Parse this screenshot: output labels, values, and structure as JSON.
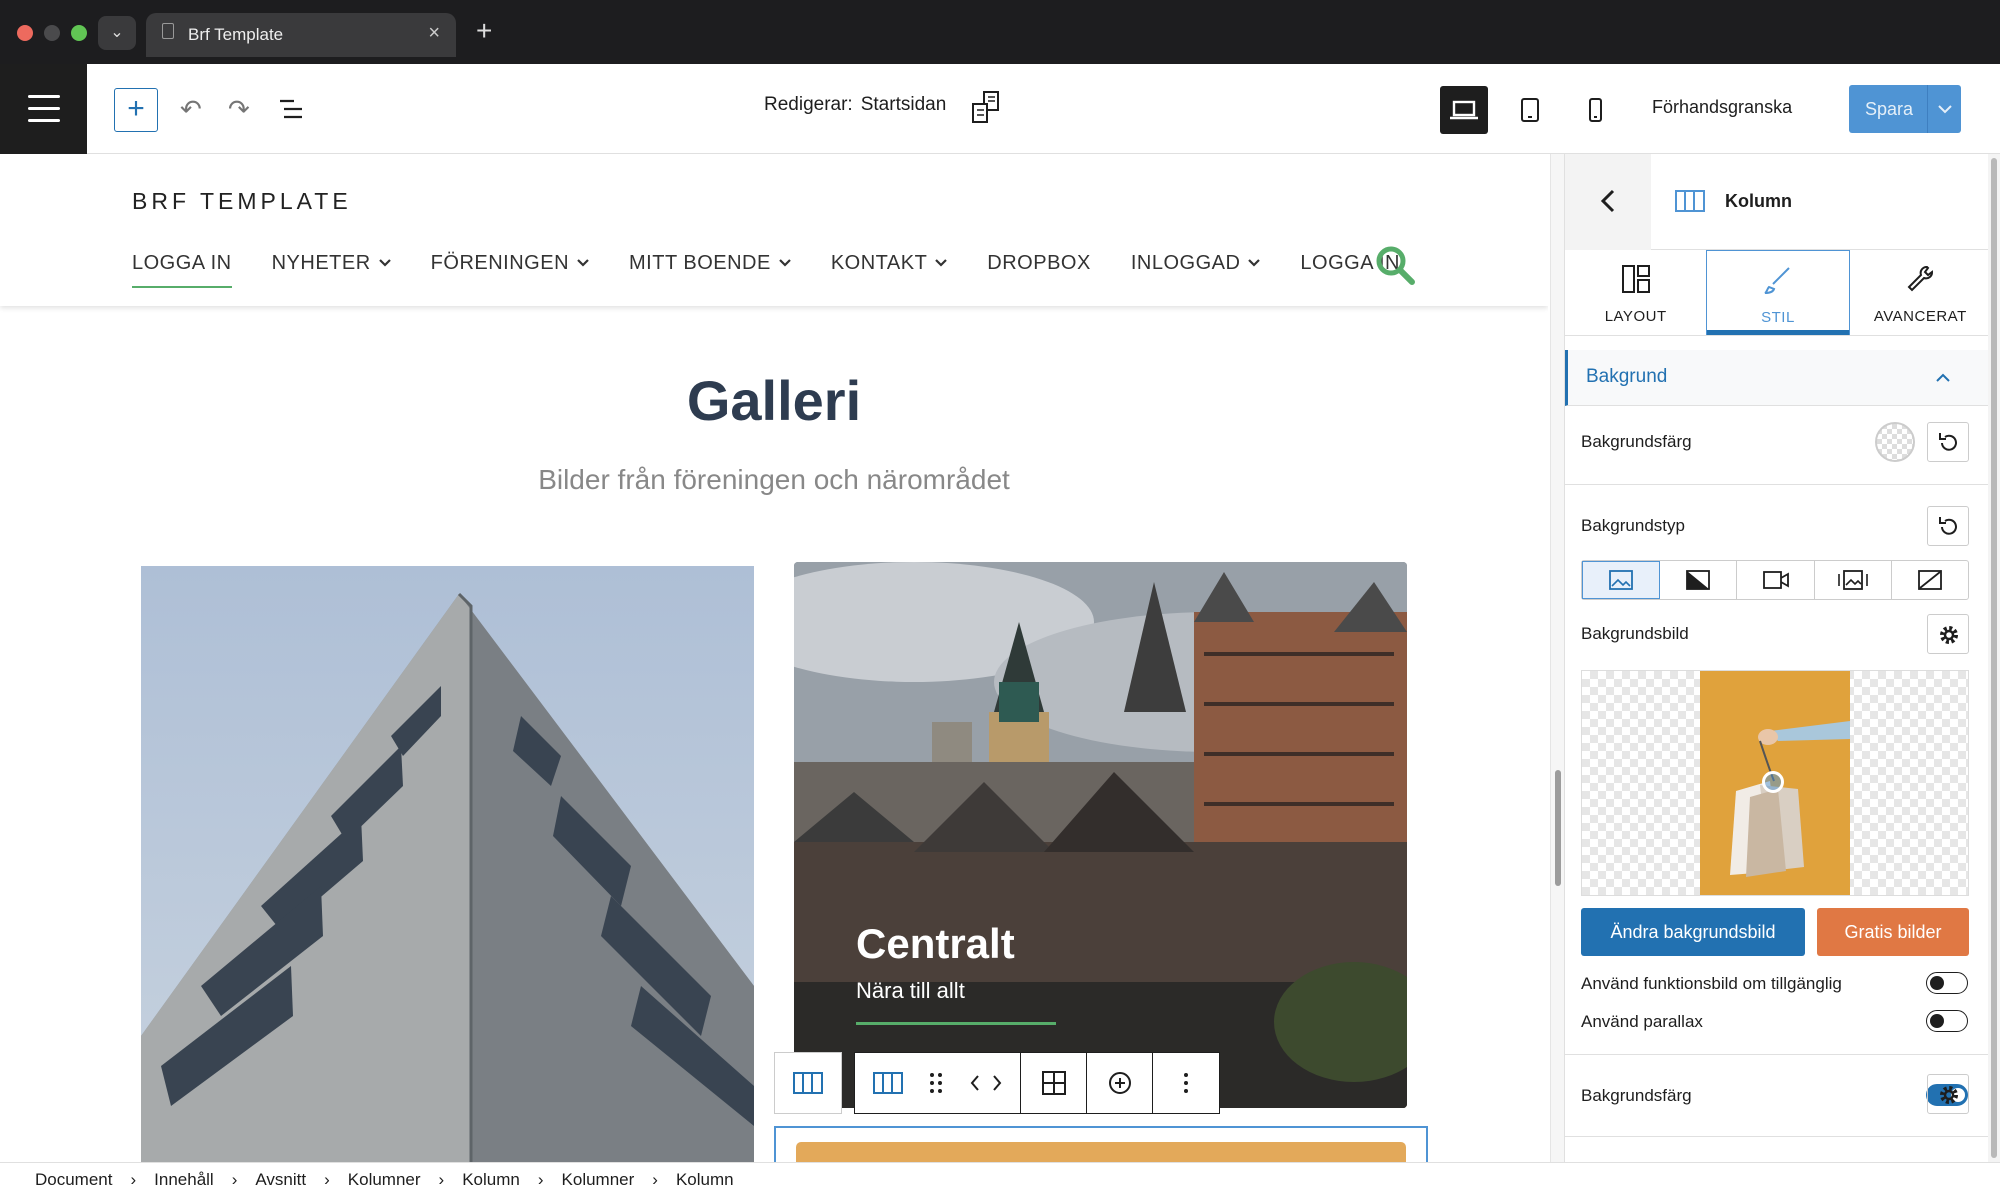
{
  "browser": {
    "tab_title": "Brf Template",
    "close_glyph": "×",
    "new_tab_glyph": "+",
    "tab_menu_glyph": "⌄"
  },
  "toolbar": {
    "editing_label": "Redigerar:",
    "editing_page": "Startsidan",
    "preview_label": "Förhandsgranska",
    "save_label": "Spara",
    "add_glyph": "+",
    "undo_glyph": "↶",
    "redo_glyph": "↷"
  },
  "site": {
    "title": "BRF TEMPLATE",
    "nav": [
      {
        "label": "LOGGA IN",
        "chev": false,
        "active": true
      },
      {
        "label": "NYHETER",
        "chev": true
      },
      {
        "label": "FÖRENINGEN",
        "chev": true
      },
      {
        "label": "MITT BOENDE",
        "chev": true
      },
      {
        "label": "KONTAKT",
        "chev": true
      },
      {
        "label": "DROPBOX",
        "chev": false
      },
      {
        "label": "INLOGGAD",
        "chev": true
      },
      {
        "label": "LOGGA IN",
        "chev": false
      }
    ],
    "accent_color": "#57ad6a"
  },
  "gallery": {
    "title": "Galleri",
    "subtitle": "Bilder från föreningen och närområdet",
    "card": {
      "title": "Centralt",
      "subtitle": "Nära till allt"
    }
  },
  "sidebar": {
    "title": "Kolumn",
    "tabs": [
      {
        "label": "LAYOUT"
      },
      {
        "label": "STIL",
        "active": true
      },
      {
        "label": "AVANCERAT"
      }
    ],
    "panel_title": "Bakgrund",
    "bg_color_label": "Bakgrundsfärg",
    "bg_type_label": "Bakgrundstyp",
    "bg_image_label": "Bakgrundsbild",
    "change_bg_button": "Ändra bakgrundsbild",
    "free_images_button": "Gratis bilder",
    "use_featured_label": "Använd funktionsbild om tillgänglig",
    "use_featured_on": false,
    "use_parallax_label": "Använd parallax",
    "use_parallax_on": false,
    "bg_color_label_2": "Bakgrundsfärg",
    "bg_color_toggle_on": true,
    "accent_color": "#2271b1"
  },
  "breadcrumb": [
    "Document",
    "Innehåll",
    "Avsnitt",
    "Kolumner",
    "Kolumn",
    "Kolumner",
    "Kolumn"
  ],
  "breadcrumb_separator": "›"
}
